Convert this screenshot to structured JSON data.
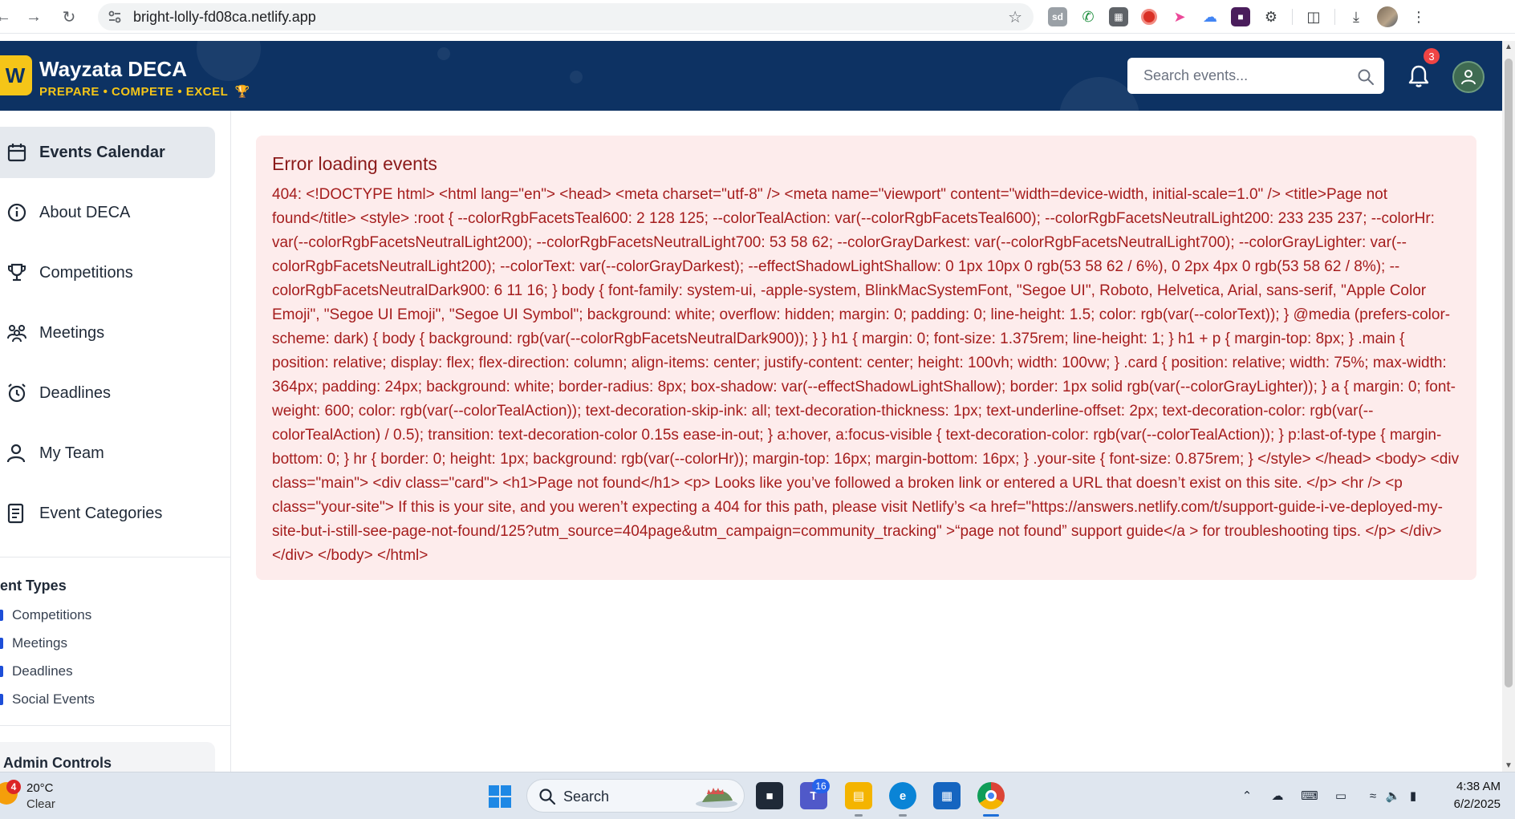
{
  "browser": {
    "url": "bright-lolly-fd08ca.netlify.app",
    "extensions": [
      {
        "name": "sd",
        "color": "#9aa0a6"
      },
      {
        "name": "phone",
        "color": "#1e8e3e"
      },
      {
        "name": "grid",
        "color": "#5f6368"
      },
      {
        "name": "record",
        "color": "#d93025"
      },
      {
        "name": "arrow",
        "color": "#ec4899"
      },
      {
        "name": "cloud",
        "color": "#4285f4"
      },
      {
        "name": "box",
        "color": "#4a1d5c"
      }
    ]
  },
  "header": {
    "logo_letter": "W",
    "title": "Wayzata DECA",
    "tagline": "PREPARE • COMPETE • EXCEL",
    "search_placeholder": "Search events...",
    "notification_count": "3",
    "colors": {
      "navy": "#0d3263",
      "gold": "#f5c518"
    }
  },
  "sidebar": {
    "nav": [
      {
        "label": "Events Calendar",
        "icon": "calendar-icon",
        "active": true
      },
      {
        "label": "About DECA",
        "icon": "info-icon",
        "active": false
      },
      {
        "label": "Competitions",
        "icon": "trophy-icon",
        "active": false
      },
      {
        "label": "Meetings",
        "icon": "people-icon",
        "active": false
      },
      {
        "label": "Deadlines",
        "icon": "alarm-icon",
        "active": false
      },
      {
        "label": "My Team",
        "icon": "user-icon",
        "active": false
      },
      {
        "label": "Event Categories",
        "icon": "list-icon",
        "active": false
      }
    ],
    "event_types_title": "vent Types",
    "event_types": [
      "Competitions",
      "Meetings",
      "Deadlines",
      "Social Events"
    ],
    "admin_title": "Admin Controls"
  },
  "main": {
    "error_title": "Error loading events",
    "error_message": "404: <!DOCTYPE html> <html lang=\"en\"> <head> <meta charset=\"utf-8\" /> <meta name=\"viewport\" content=\"width=device-width, initial-scale=1.0\" /> <title>Page not found</title> <style> :root { --colorRgbFacetsTeal600: 2 128 125; --colorTealAction: var(--colorRgbFacetsTeal600); --colorRgbFacetsNeutralLight200: 233 235 237; --colorHr: var(--colorRgbFacetsNeutralLight200); --colorRgbFacetsNeutralLight700: 53 58 62; --colorGrayDarkest: var(--colorRgbFacetsNeutralLight700); --colorGrayLighter: var(--colorRgbFacetsNeutralLight200); --colorText: var(--colorGrayDarkest); --effectShadowLightShallow: 0 1px 10px 0 rgb(53 58 62 / 6%), 0 2px 4px 0 rgb(53 58 62 / 8%); --colorRgbFacetsNeutralDark900: 6 11 16; } body { font-family: system-ui, -apple-system, BlinkMacSystemFont, \"Segoe UI\", Roboto, Helvetica, Arial, sans-serif, \"Apple Color Emoji\", \"Segoe UI Emoji\", \"Segoe UI Symbol\"; background: white; overflow: hidden; margin: 0; padding: 0; line-height: 1.5; color: rgb(var(--colorText)); } @media (prefers-color-scheme: dark) { body { background: rgb(var(--colorRgbFacetsNeutralDark900)); } } h1 { margin: 0; font-size: 1.375rem; line-height: 1; } h1 + p { margin-top: 8px; } .main { position: relative; display: flex; flex-direction: column; align-items: center; justify-content: center; height: 100vh; width: 100vw; } .card { position: relative; width: 75%; max-width: 364px; padding: 24px; background: white; border-radius: 8px; box-shadow: var(--effectShadowLightShallow); border: 1px solid rgb(var(--colorGrayLighter)); } a { margin: 0; font-weight: 600; color: rgb(var(--colorTealAction)); text-decoration-skip-ink: all; text-decoration-thickness: 1px; text-underline-offset: 2px; text-decoration-color: rgb(var(--colorTealAction) / 0.5); transition: text-decoration-color 0.15s ease-in-out; } a:hover, a:focus-visible { text-decoration-color: rgb(var(--colorTealAction)); } p:last-of-type { margin-bottom: 0; } hr { border: 0; height: 1px; background: rgb(var(--colorHr)); margin-top: 16px; margin-bottom: 16px; } .your-site { font-size: 0.875rem; } </style> </head> <body> <div class=\"main\"> <div class=\"card\"> <h1>Page not found</h1> <p> Looks like you’ve followed a broken link or entered a URL that doesn’t exist on this site. </p> <hr /> <p class=\"your-site\"> If this is your site, and you weren’t expecting a 404 for this path, please visit Netlify’s <a href=\"https://answers.netlify.com/t/support-guide-i-ve-deployed-my-site-but-i-still-see-page-not-found/125?utm_source=404page&utm_campaign=community_tracking\" >“page not found” support guide</a > for troubleshooting tips. </p> </div> </div> </body> </html>"
  },
  "taskbar": {
    "weather_badge": "4",
    "temperature": "20°C",
    "condition": "Clear",
    "search_label": "Search",
    "teams_badge": "16",
    "time": "4:38 AM",
    "date": "6/2/2025"
  }
}
